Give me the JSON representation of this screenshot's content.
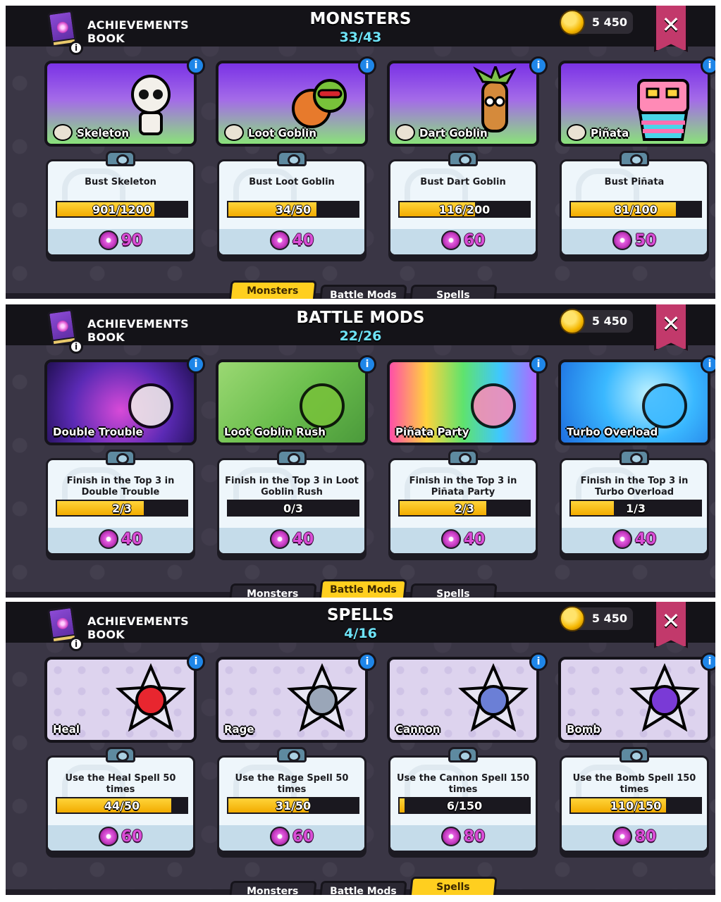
{
  "colors": {
    "accent": "#ffcf1f",
    "count": "#6ee3f7",
    "gem": "#d94dd6",
    "info": "#1f86e8",
    "close": "#c2396b"
  },
  "panels": [
    {
      "book_title": "ACHIEVEMENTS BOOK",
      "title": "MONSTERS",
      "count": "33/43",
      "coins": "5 450",
      "close_icon": "✕",
      "cards": [
        {
          "name": "Skeleton",
          "icon": "skeleton-icon",
          "task": "Bust Skeleton",
          "progress": "901/1200",
          "fraction": 0.75,
          "reward": "90"
        },
        {
          "name": "Loot Goblin",
          "icon": "loot-goblin-icon",
          "task": "Bust Loot Goblin",
          "progress": "34/50",
          "fraction": 0.68,
          "reward": "40"
        },
        {
          "name": "Dart Goblin",
          "icon": "dart-goblin-icon",
          "task": "Bust Dart Goblin",
          "progress": "116/200",
          "fraction": 0.58,
          "reward": "60"
        },
        {
          "name": "Piñata",
          "icon": "pinata-icon",
          "task": "Bust Piñata",
          "progress": "81/100",
          "fraction": 0.81,
          "reward": "50"
        }
      ],
      "tabs": [
        "Monsters",
        "Battle Mods",
        "Spells"
      ],
      "active_tab": 0
    },
    {
      "book_title": "ACHIEVEMENTS BOOK",
      "title": "BATTLE MODS",
      "count": "22/26",
      "coins": "5 450",
      "close_icon": "✕",
      "cards": [
        {
          "name": "Double Trouble",
          "icon": "double-trouble-icon",
          "task": "Finish in the Top 3 in Double Trouble",
          "progress": "2/3",
          "fraction": 0.667,
          "reward": "40"
        },
        {
          "name": "Loot Goblin Rush",
          "icon": "loot-goblin-rush-icon",
          "task": "Finish in the Top 3 in Loot Goblin Rush",
          "progress": "0/3",
          "fraction": 0,
          "reward": "40"
        },
        {
          "name": "Piñata Party",
          "icon": "pinata-party-icon",
          "task": "Finish in the Top 3 in Piñata Party",
          "progress": "2/3",
          "fraction": 0.667,
          "reward": "40"
        },
        {
          "name": "Turbo Overload",
          "icon": "turbo-overload-icon",
          "task": "Finish in the Top 3 in Turbo Overload",
          "progress": "1/3",
          "fraction": 0.333,
          "reward": "40"
        }
      ],
      "tabs": [
        "Monsters",
        "Battle Mods",
        "Spells"
      ],
      "active_tab": 1
    },
    {
      "book_title": "ACHIEVEMENTS BOOK",
      "title": "SPELLS",
      "count": "4/16",
      "coins": "5 450",
      "close_icon": "✕",
      "cards": [
        {
          "name": "Heal",
          "icon": "heart-icon",
          "task": "Use the Heal Spell 50 times",
          "progress": "44/50",
          "fraction": 0.88,
          "reward": "60"
        },
        {
          "name": "Rage",
          "icon": "sword-icon",
          "task": "Use the Rage Spell 50 times",
          "progress": "31/50",
          "fraction": 0.62,
          "reward": "60"
        },
        {
          "name": "Cannon",
          "icon": "cannon-icon",
          "task": "Use the Cannon Spell 150 times",
          "progress": "6/150",
          "fraction": 0.04,
          "reward": "80"
        },
        {
          "name": "Bomb",
          "icon": "bomb-icon",
          "task": "Use the Bomb Spell 150 times",
          "progress": "110/150",
          "fraction": 0.733,
          "reward": "80"
        }
      ],
      "tabs": [
        "Monsters",
        "Battle Mods",
        "Spells"
      ],
      "active_tab": 2
    }
  ]
}
